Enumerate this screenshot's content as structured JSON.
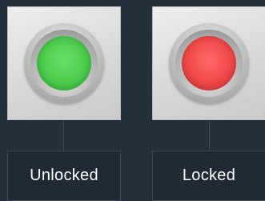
{
  "indicators": [
    {
      "label": "Unlocked",
      "state": "unlocked",
      "color": "#4ccc4c"
    },
    {
      "label": "Locked",
      "state": "locked",
      "color": "#f04848"
    }
  ],
  "theme": {
    "background": "#232f3a",
    "panel": "#dcdcdc",
    "label_box_background": "#1f2a34",
    "label_text": "#ffffff",
    "connector": "#3d4b58"
  }
}
